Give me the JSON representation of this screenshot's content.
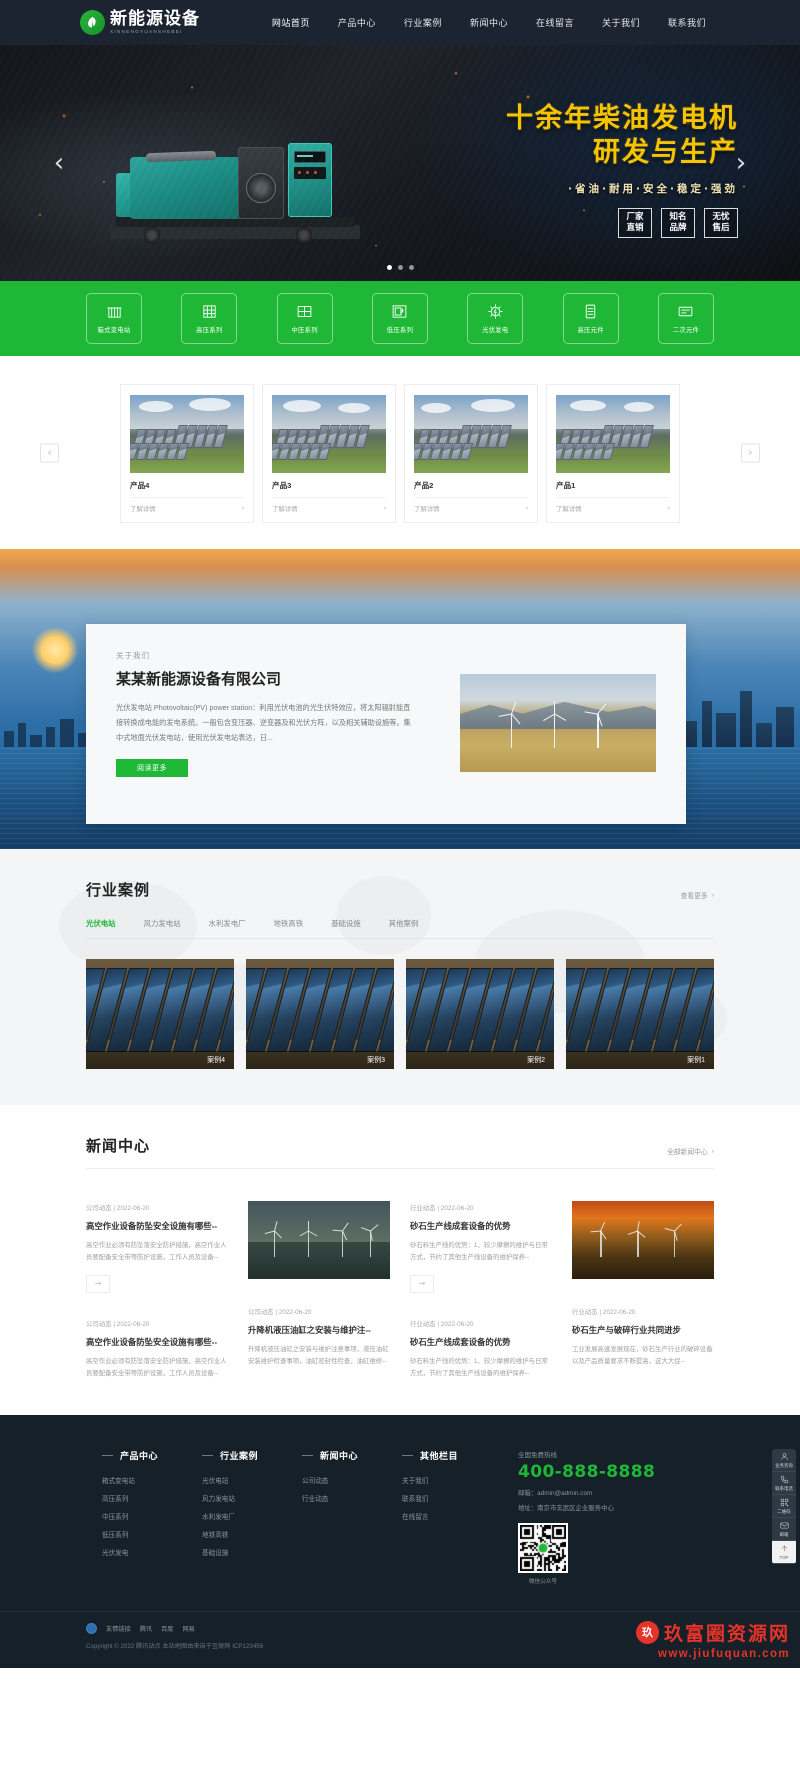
{
  "header": {
    "logo_cn": "新能源设备",
    "logo_en": "XINNENGYUANSHEBEI",
    "nav": [
      {
        "label": "网站首页",
        "active": true
      },
      {
        "label": "产品中心",
        "active": false
      },
      {
        "label": "行业案例",
        "active": false
      },
      {
        "label": "新闻中心",
        "active": false
      },
      {
        "label": "在线留言",
        "active": false
      },
      {
        "label": "关于我们",
        "active": false
      },
      {
        "label": "联系我们",
        "active": false
      }
    ]
  },
  "banner": {
    "title_line1": "十余年柴油发电机",
    "title_line2": "研发与生产",
    "subtitle": "·省油·耐用·安全·稳定·强劲",
    "badges": [
      {
        "line1": "厂家",
        "line2": "直销"
      },
      {
        "line1": "知名",
        "line2": "品牌"
      },
      {
        "line1": "无忧",
        "line2": "售后"
      }
    ],
    "prev": "‹",
    "next": "›",
    "dots": 3,
    "active_dot": 0
  },
  "categories": [
    {
      "label": "箱式变电站",
      "icon": "substation-icon"
    },
    {
      "label": "高压系列",
      "icon": "high-voltage-icon"
    },
    {
      "label": "中压系列",
      "icon": "medium-voltage-icon"
    },
    {
      "label": "低压系列",
      "icon": "low-voltage-icon"
    },
    {
      "label": "光伏发电",
      "icon": "solar-power-icon"
    },
    {
      "label": "高压元件",
      "icon": "high-voltage-part-icon"
    },
    {
      "label": "二次元件",
      "icon": "secondary-part-icon"
    }
  ],
  "products": {
    "prev": "‹",
    "next": "›",
    "more_label": "了解详情",
    "more_arrow": "›",
    "items": [
      {
        "name": "产品4"
      },
      {
        "name": "产品3"
      },
      {
        "name": "产品2"
      },
      {
        "name": "产品1"
      }
    ]
  },
  "about": {
    "kicker": "关于我们",
    "title": "某某新能源设备有限公司",
    "body": "光伏发电站 Photovoltaic(PV) power station：利用光伏电池的光生伏特效应，将太阳辐射能直接转换成电能的发电系统。一般包含变压器、逆变器及和光伏方阵，以及相关辅助设施等。集中式地面光伏发电站，使用光伏发电站表达，日...",
    "button": "阅读更多"
  },
  "cases": {
    "title": "行业案例",
    "more": "查看更多",
    "more_arrow": "›",
    "tabs": [
      {
        "label": "光伏电站",
        "active": true
      },
      {
        "label": "风力发电站",
        "active": false
      },
      {
        "label": "水利发电厂",
        "active": false
      },
      {
        "label": "地铁高铁",
        "active": false
      },
      {
        "label": "基础设施",
        "active": false
      },
      {
        "label": "其他案例",
        "active": false
      }
    ],
    "items": [
      {
        "label": "案例4"
      },
      {
        "label": "案例3"
      },
      {
        "label": "案例2"
      },
      {
        "label": "案例1"
      }
    ]
  },
  "news": {
    "title": "新闻中心",
    "more": "全部新闻中心",
    "more_arrow": "›",
    "arrow_glyph": "→",
    "columns": [
      {
        "items": [
          {
            "meta": "公司动态 | 2022-06-20",
            "title": "高空作业设备防坠安全设施有哪些--",
            "desc": "高空作业必须有防坠落安全防护措施，高空作业人员要配备安全带等防护设施，工作人员及设备--",
            "has_arrow": true,
            "has_pic": false,
            "pic": ""
          },
          {
            "meta": "公司动态 | 2022-06-20",
            "title": "高空作业设备防坠安全设施有哪些--",
            "desc": "高空作业必须有防坠落安全防护措施，高空作业人员要配备安全带等防护设施，工作人员及设备--",
            "has_arrow": false,
            "has_pic": false,
            "pic": ""
          }
        ]
      },
      {
        "items": [
          {
            "meta": "",
            "title": "",
            "desc": "",
            "has_arrow": false,
            "has_pic": true,
            "pic": "night"
          },
          {
            "meta": "公司动态 | 2022-06-20",
            "title": "升降机液压油缸之安装与维护注--",
            "desc": "升降机液压油缸之安装与维护注意事项，液压油缸安装维护检查事项，油缸密封性检查，油缸维修--",
            "has_arrow": false,
            "has_pic": false,
            "pic": ""
          }
        ]
      },
      {
        "items": [
          {
            "meta": "行业动态 | 2022-06-20",
            "title": "砂石生产线成套设备的优势",
            "desc": "砂石料生产线的优势：1、较少摩擦的维护与日常方式，节约了其他生产线设备的维护保养--",
            "has_arrow": true,
            "has_pic": false,
            "pic": ""
          },
          {
            "meta": "行业动态 | 2022-06-20",
            "title": "砂石生产线成套设备的优势",
            "desc": "砂石料生产线的优势：1、较少摩擦的维护与日常方式，节约了其他生产线设备的维护保养--",
            "has_arrow": false,
            "has_pic": false,
            "pic": ""
          }
        ]
      },
      {
        "items": [
          {
            "meta": "",
            "title": "",
            "desc": "",
            "has_arrow": false,
            "has_pic": true,
            "pic": "sunset"
          },
          {
            "meta": "行业动态 | 2022-06-20",
            "title": "砂石生产与破碎行业共同进步",
            "desc": "工业发展高速发展现在，砂石生产行业的破碎设备以及产品质量要求不断提高，这大大促--",
            "has_arrow": false,
            "has_pic": false,
            "pic": ""
          }
        ]
      }
    ]
  },
  "footer": {
    "columns": [
      {
        "title": "产品中心",
        "links": [
          "箱式变电站",
          "高压系列",
          "中压系列",
          "低压系列",
          "光伏发电"
        ]
      },
      {
        "title": "行业案例",
        "links": [
          "光伏电站",
          "风力发电站",
          "水利发电厂",
          "地铁高铁",
          "基础设施"
        ]
      },
      {
        "title": "新闻中心",
        "links": [
          "公司动态",
          "行业动态"
        ]
      },
      {
        "title": "其他栏目",
        "links": [
          "关于我们",
          "联系我们",
          "在线留言"
        ]
      }
    ],
    "hotline_label": "全国免费热线",
    "phone": "400-888-8888",
    "email": "邮箱：admin@admin.com",
    "address": "地址：南京市玄武区企业服务中心",
    "qr_caption": "微信公众号",
    "share_label": "友情链接",
    "share_links": [
      "腾讯",
      "百度",
      "网易"
    ],
    "copyright": "Copyright © 2022 腾讯站点 本站地图由来自于互联网 ICP123456"
  },
  "sidebar": [
    {
      "label": "业务咨询",
      "icon": "user-icon"
    },
    {
      "label": "联系电话",
      "icon": "phone-icon"
    },
    {
      "label": "二维码",
      "icon": "qrcode-icon"
    },
    {
      "label": "邮箱",
      "icon": "mail-icon"
    },
    {
      "label": "TOP",
      "icon": "arrow-up-icon"
    }
  ],
  "watermark": {
    "badge": "玖",
    "text": "玖富圈资源网",
    "url": "www.jiufuquan.com"
  },
  "colors": {
    "brand_green": "#1eb836",
    "header_dark": "#1b2430",
    "footer_dark": "#162029",
    "banner_gold": "#f5c400",
    "watermark_red": "#e63329"
  }
}
